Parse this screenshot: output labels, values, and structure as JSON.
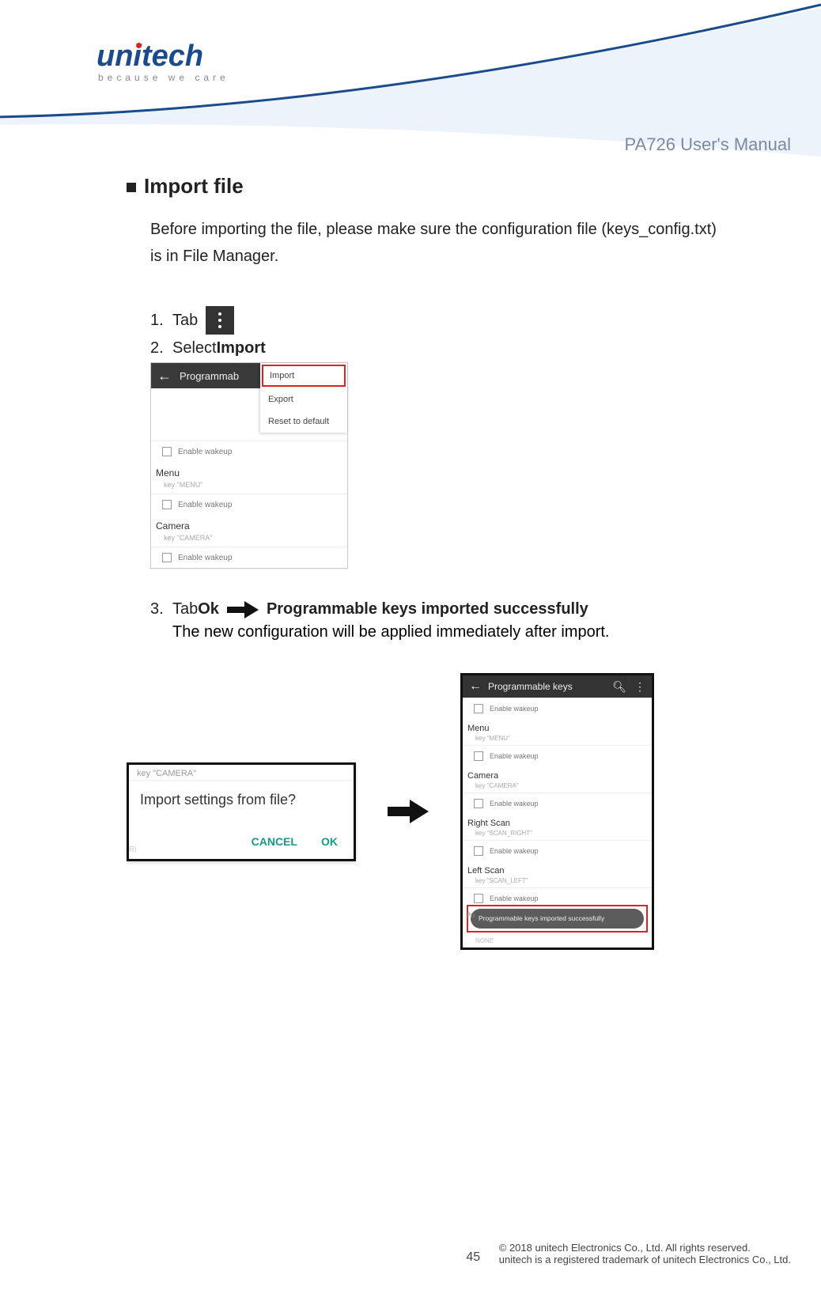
{
  "header": {
    "logo_main": "unitech",
    "logo_tagline": "because we care",
    "manual_name": "PA726 User's Manual"
  },
  "section": {
    "title": "Import file",
    "intro": "Before importing the file, please make sure the configuration file (keys_config.txt) is in File Manager."
  },
  "steps": {
    "s1_num": "1.",
    "s1_text": "Tab",
    "s2_num": "2.",
    "s2_text": "Select ",
    "s2_bold": "Import",
    "s3_num": "3.",
    "s3_text_a": "Tab ",
    "s3_bold_a": "Ok",
    "s3_bold_b": "Programmable keys imported successfully",
    "s3_body": "The new configuration will be applied immediately after import."
  },
  "shot1": {
    "title": "Programmab",
    "menu": {
      "import": "Import",
      "export": "Export",
      "reset": "Reset to default"
    },
    "enable_wakeup": "Enable wakeup",
    "menu_section": "Menu",
    "menu_key": "key \"MENU\"",
    "camera_section": "Camera",
    "camera_key": "key \"CAMERA\""
  },
  "shot2": {
    "dim": "key \"CAMERA\"",
    "title": "Import settings from file?",
    "cancel": "CANCEL",
    "ok": "OK",
    "dim2": "Ri"
  },
  "shot3": {
    "title": "Programmable keys",
    "enable_wakeup": "Enable wakeup",
    "menu_section": "Menu",
    "menu_key": "key \"MENU\"",
    "camera_section": "Camera",
    "camera_key": "key \"CAMERA\"",
    "right_section": "Right Scan",
    "right_key": "key \"SCAN_RIGHT\"",
    "left_section": "Left Scan",
    "left_key": "key \"SCAN_LEFT\"",
    "toast": "Programmable keys imported successfully",
    "none": "NONE",
    "pu": "Pu"
  },
  "footer": {
    "page": "45",
    "line1": "© 2018 unitech Electronics Co., Ltd. All rights reserved.",
    "line2": "unitech is a registered trademark of unitech Electronics Co., Ltd."
  }
}
